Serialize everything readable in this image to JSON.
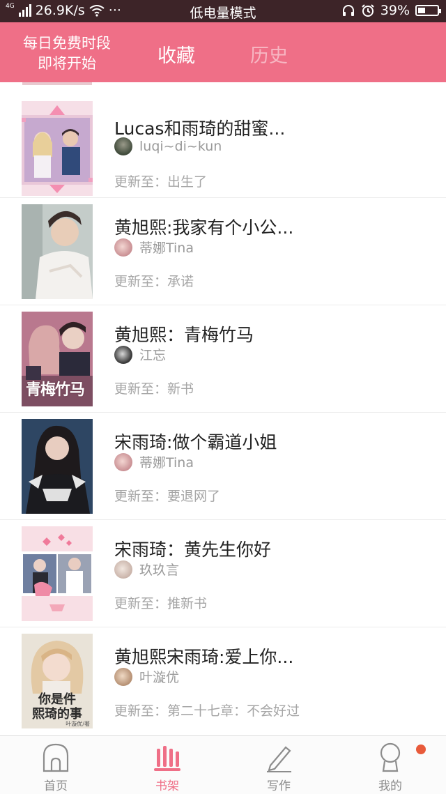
{
  "status_bar": {
    "network": "4G",
    "speed": "26.9K/s",
    "more": "···",
    "mode": "低电量模式",
    "battery": "39%",
    "battery_level": 0.39
  },
  "header": {
    "free_line1": "每日免费时段",
    "free_line2": "即将开始",
    "tab_favorites": "收藏",
    "tab_history": "历史"
  },
  "books": [
    {
      "title": "Lucas和雨琦的甜蜜...",
      "author": "luqi~di~kun",
      "update": "更新至：出生了"
    },
    {
      "title": "黄旭熙:我家有个小公...",
      "author": "蒂娜Tina",
      "update": "更新至：承诺"
    },
    {
      "title": "黄旭熙：青梅竹马",
      "author": "江忘",
      "update": "更新至：新书"
    },
    {
      "title": "宋雨琦:做个霸道小姐",
      "author": "蒂娜Tina",
      "update": "更新至：要退网了"
    },
    {
      "title": "宋雨琦：黄先生你好",
      "author": "玖玖言",
      "update": "更新至：推新书"
    },
    {
      "title": "黄旭熙宋雨琦:爱上你...",
      "author": "叶漩优",
      "update": "更新至：第二十七章：不会好过"
    }
  ],
  "cover_text": {
    "book3_line1": "青梅竹马",
    "book6_line1": "你是件",
    "book6_line2": "熙琦的事",
    "book6_author": "叶漩优/著"
  },
  "nav": {
    "home": "首页",
    "shelf": "书架",
    "write": "写作",
    "mine": "我的"
  },
  "colors": {
    "accent": "#ef6f87",
    "status_bar": "#3d2428",
    "badge": "#e85a3a"
  }
}
